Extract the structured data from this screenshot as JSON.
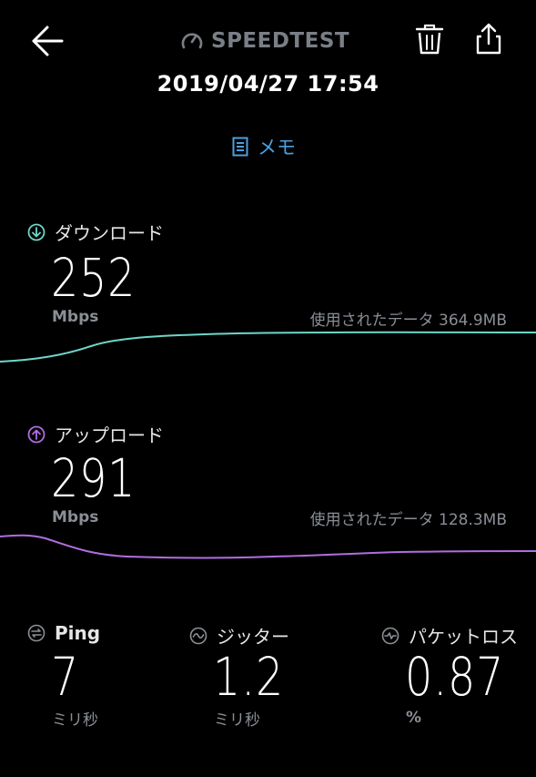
{
  "header": {
    "app_title": "SPEEDTEST",
    "datetime": "2019/04/27 17:54",
    "memo_label": "メモ"
  },
  "download": {
    "label": "ダウンロード",
    "value": "252",
    "unit": "Mbps",
    "used_label": "使用されたデータ",
    "used_value": "364.9MB",
    "color": "#6fd6c9"
  },
  "upload": {
    "label": "アップロード",
    "value": "291",
    "unit": "Mbps",
    "used_label": "使用されたデータ",
    "used_value": "128.3MB",
    "color": "#b06ee0"
  },
  "stats": {
    "ping": {
      "label": "Ping",
      "value": "7",
      "unit": "ミリ秒"
    },
    "jitter": {
      "label": "ジッター",
      "value": "1.2",
      "unit": "ミリ秒"
    },
    "packet_loss": {
      "label": "パケットロス",
      "value": "0.87",
      "unit": "%"
    }
  },
  "colors": {
    "accent_blue": "#4a9fe0",
    "text_gray": "#8a8f96"
  }
}
